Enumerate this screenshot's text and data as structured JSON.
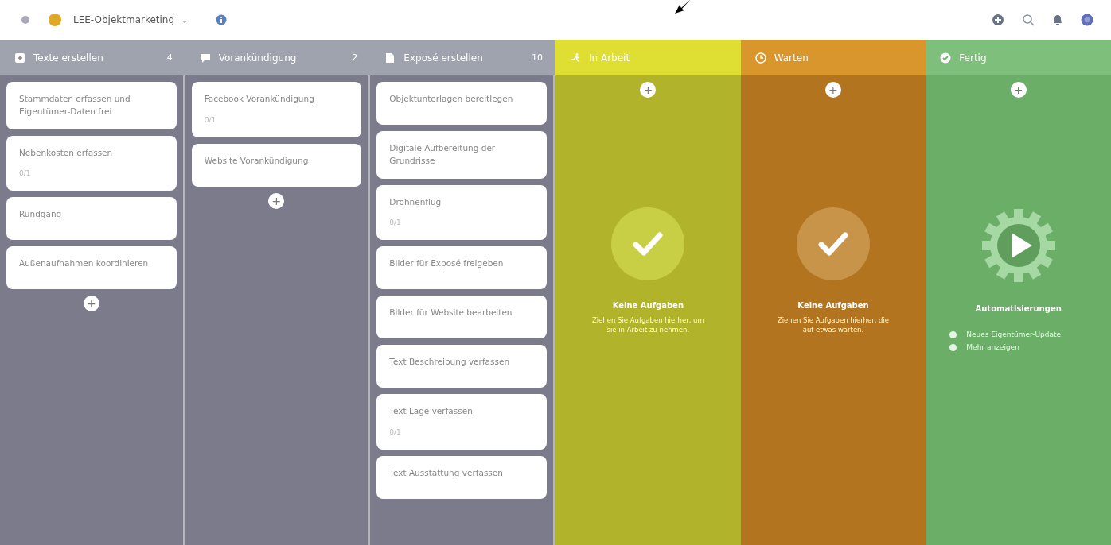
{
  "project": {
    "name": "LEE-Objektmarketing",
    "caret": "⌄"
  },
  "columns": [
    {
      "kind": "tasks",
      "title": "Texte erstellen",
      "count": "4",
      "add": "+",
      "cards": [
        {
          "title": "Stammdaten erfassen und Eigentümer-Daten frei"
        },
        {
          "title": "Nebenkosten erfassen",
          "meta": "0/1"
        },
        {
          "title": "Rundgang"
        },
        {
          "title": "Außenaufnahmen koordinieren"
        }
      ]
    },
    {
      "kind": "tasks",
      "title": "Vorankündigung",
      "count": "2",
      "add": "+",
      "cards": [
        {
          "title": "Facebook Vorankündigung",
          "meta": "0/1"
        },
        {
          "title": "Website Vorankündigung"
        }
      ]
    },
    {
      "kind": "tasks",
      "title": "Exposé erstellen",
      "count": "10",
      "cards": [
        {
          "title": "Objektunterlagen bereitlegen"
        },
        {
          "title": "Digitale Aufbereitung der Grundrisse"
        },
        {
          "title": "Drohnenflug",
          "meta": "0/1"
        },
        {
          "title": "Bilder für Exposé freigeben"
        },
        {
          "title": "Bilder für Website bearbeiten"
        },
        {
          "title": "Text Beschreibung verfassen"
        },
        {
          "title": "Text Lage verfassen",
          "meta": "0/1"
        },
        {
          "title": "Text Ausstattung verfassen"
        }
      ]
    },
    {
      "kind": "empty",
      "title": "In Arbeit",
      "add": "+",
      "heading": "Keine Aufgaben",
      "text": "Ziehen Sie Aufgaben hierher, um sie in Arbeit zu nehmen."
    },
    {
      "kind": "empty",
      "title": "Warten",
      "add": "+",
      "heading": "Keine Aufgaben",
      "text": "Ziehen Sie Aufgaben hierher, die auf etwas warten."
    },
    {
      "kind": "auto",
      "title": "Fertig",
      "add": "+",
      "heading": "Automatisierungen",
      "links": [
        "Neues Eigentümer-Update",
        "Mehr anzeigen"
      ]
    }
  ]
}
